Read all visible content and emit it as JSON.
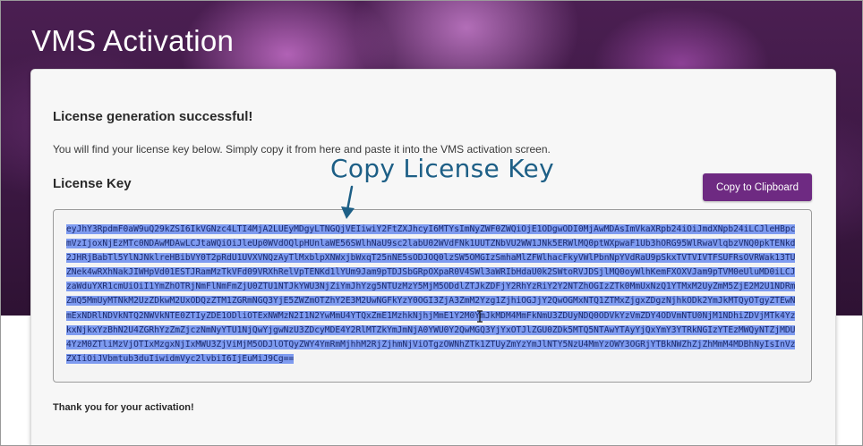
{
  "page": {
    "title": "VMS Activation"
  },
  "card": {
    "success_message": "License generation successful!",
    "instructions": "You will find your license key below. Simply copy it from here and paste it into the VMS activation screen.",
    "license_key_heading": "License Key",
    "copy_button_label": "Copy to Clipboard",
    "license_key": "eyJhY3RpdmF0aW9uQ29kZSI6IkVGNzc4LTI4MjA2LUEyMDgyLTNGQjVEIiwiY2FtZXJhcyI6MTYsImNyZWF0ZWQiOjE1ODgwODI0MjAwMDAsImVkaXRpb24iOiJmdXNpb24iLCJleHBpcmVzIjoxNjEzMTc0NDAwMDAwLCJtaWQiOiJleUp0WVdOQlpHUnlaWE56SWlhNaU9sc2labU02WVdFNk1UUTZNbVU2WW1JNk5ERWlMQ0ptWXpwaF1Ub3hORG95WlRwaVlqbzVNQ0pkTENkd2JHRjBabTl5YlNJNklreHBibVY0T2pRdU1UVXVNQzAyTlMxblpXNWxjbWxqT25nNE5sODJOQ0lzSW5OMGIzSmhaMlZFWlhacFkyVWlPbnNpYVdRaU9pSkxTVTVIVTFSUFRsOVRWak13TUZNek4wRXhNakJIWHpVd01ESTJRamMzTkVFd09VRXhRelVpTENKd1lYUm9Jam9pTDJSbGRpOXpaR0V4SWl3aWRIbHdaU0k2SWtoRVJDSjlMQ0oyWlhKemFXOXVJam9pTVM0eUluMD0iLCJzaWduYXR1cmUiOiI1YmZhOTRjNmFlNmFmZjU0ZTU1NTJkYWU3NjZiYmJhYzg5NTUzMzY5MjM5ODdlZTJkZDFjY2RhYzRiY2Y2NTZhOGIzZTk0MmUxNzQ1YTMxM2UyZmM5ZjE2M2U1NDRmZmQ5MmUyMTNkM2UzZDkwM2UxODQzZTM1ZGRmNGQ3YjE5ZWZmOTZhY2E3M2UwNGFkYzY0OGI3ZjA3ZmM2Yzg1ZjhiOGJjY2QwOGMxNTQ1ZTMxZjgxZDgzNjhkODk2YmJkMTQyOTgyZTEwNmExNDRlNDVkNTQ2NWVkNTE0ZTIyZDE1ODliOTExNWMzN2I1N2YwMmU4YTQxZmE1MzhkNjhjMmE1Y2M0YmJkMDM4MmFkNmU3ZDUyNDQ0ODVkYzVmZDY4ODVmNTU0NjM1NDhiZDVjMTk4YzkxNjkxYzBhN2U4ZGRhYzZmZjczNmNyYTU1NjQwYjgwNzU3ZDcyMDE4Y2RlMTZkYmJmNjA0YWU0Y2QwMGQ3YjYxOTJlZGU0ZDk5MTQ5NTAwYTAyYjQxYmY3YTRkNGIzYTEzMWQyNTZjMDU4YzM0ZTliMzVjOTIxMzgxNjIxMWU3ZjViMjM5ODJlOTQyZWY4YmRmMjhhM2RjZjhmNjViOTgzOWNhZTk1ZTUyZmYzYmJlNTY5NzU4MmYzOWY3OGRjYTBkNWZhZjZhMmM4MDBhNyIsInVzZXIiOiJVbmtub3duIiwidmVyc2lvbiI6IjEuMiJ9Cg==",
    "thanks_message": "Thank you for your activation!"
  },
  "annotation": {
    "label": "Copy License Key"
  },
  "colors": {
    "accent": "#6e2a82",
    "annotation": "#1d5f86",
    "selection": "#7e9bf0"
  }
}
